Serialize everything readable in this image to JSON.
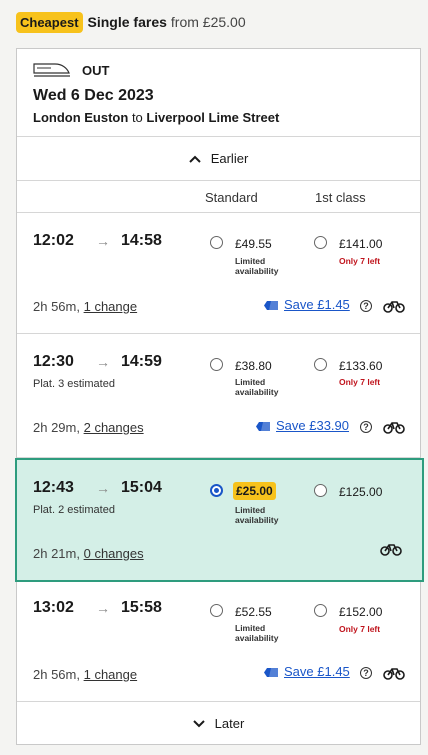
{
  "header": {
    "badge": "Cheapest",
    "fare_type": "Single fares",
    "from_price": "from £25.00"
  },
  "journey": {
    "direction": "OUT",
    "date": "Wed 6 Dec 2023",
    "origin": "London Euston",
    "connector": "to",
    "destination": "Liverpool Lime Street"
  },
  "nav": {
    "earlier": "Earlier",
    "later": "Later"
  },
  "columns": {
    "standard": "Standard",
    "first": "1st class"
  },
  "arrow_glyph": "→",
  "info_glyph": "?",
  "trains": [
    {
      "dep": "12:02",
      "arr": "14:58",
      "platform": "",
      "duration": "2h 56m,",
      "changes": "1 change",
      "std_price": "£49.55",
      "std_avail": "Limited availability",
      "first_price": "£141.00",
      "first_note": "Only 7 left",
      "save": "Save £1.45",
      "selected": false
    },
    {
      "dep": "12:30",
      "arr": "14:59",
      "platform": "Plat. 3 estimated",
      "duration": "2h 29m,",
      "changes": "2 changes",
      "std_price": "£38.80",
      "std_avail": "Limited availability",
      "first_price": "£133.60",
      "first_note": "Only 7 left",
      "save": "Save £33.90",
      "selected": false
    },
    {
      "dep": "12:43",
      "arr": "15:04",
      "platform": "Plat. 2 estimated",
      "duration": "2h 21m,",
      "changes": "0 changes",
      "std_price": "£25.00",
      "std_avail": "Limited availability",
      "first_price": "£125.00",
      "first_note": "",
      "save": "",
      "selected": true
    },
    {
      "dep": "13:02",
      "arr": "15:58",
      "platform": "",
      "duration": "2h 56m,",
      "changes": "1 change",
      "std_price": "£52.55",
      "std_avail": "Limited availability",
      "first_price": "£152.00",
      "first_note": "Only 7 left",
      "save": "Save £1.45",
      "selected": false
    }
  ],
  "colors": {
    "badge": "#f7c21c",
    "selected_bg": "#d4efe7",
    "selected_border": "#2e9c7e",
    "link_blue": "#1a56c8",
    "warning_red": "#c0141d"
  },
  "icons": [
    "train-icon",
    "chevron-up-icon",
    "chevron-down-icon",
    "railcard-tag-icon",
    "info-icon",
    "bike-icon"
  ]
}
